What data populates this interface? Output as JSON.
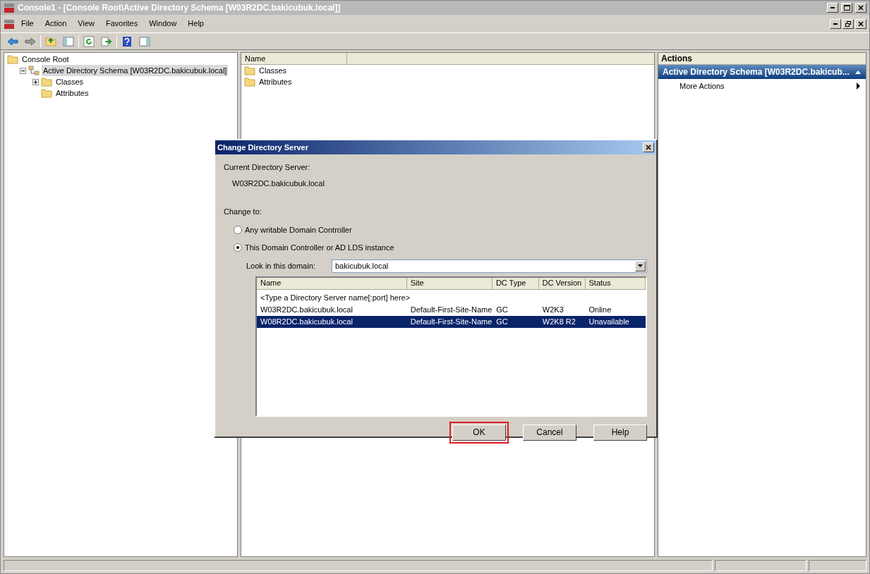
{
  "window": {
    "title": "Console1 - [Console Root\\Active Directory Schema [W03R2DC.bakicubuk.local]]"
  },
  "menu": [
    "File",
    "Action",
    "View",
    "Favorites",
    "Window",
    "Help"
  ],
  "tree": [
    {
      "label": "Console Root",
      "selected": false,
      "children": [
        {
          "label": "Active Directory Schema [W03R2DC.bakicubuk.local]",
          "kind": "branch",
          "expanded": true,
          "selected": true,
          "children": [
            {
              "label": "Classes",
              "kind": "branch",
              "expanded": false,
              "selected": false
            },
            {
              "label": "Attributes",
              "kind": "leaf",
              "selected": false
            }
          ]
        }
      ]
    }
  ],
  "list": {
    "columns": [
      "Name"
    ],
    "items": [
      "Classes",
      "Attributes"
    ]
  },
  "actions": {
    "title": "Actions",
    "section": "Active Directory Schema [W03R2DC.bakicub...",
    "items": [
      "More Actions"
    ]
  },
  "dialog": {
    "title": "Change Directory Server",
    "current_label": "Current Directory Server:",
    "current_value": "W03R2DC.bakicubuk.local",
    "change_label": "Change to:",
    "options": [
      {
        "label": "Any writable Domain Controller",
        "selected": false
      },
      {
        "label": "This Domain Controller or AD LDS instance",
        "selected": true
      }
    ],
    "domain_label": "Look in this domain:",
    "domain_value": "bakicubuk.local",
    "table": {
      "columns": [
        "Name",
        "Site",
        "DC Type",
        "DC Version",
        "Status"
      ],
      "rows": [
        {
          "cells": [
            "<Type a Directory Server name[:port] here>"
          ],
          "selected": false
        },
        {
          "cells": [
            "W03R2DC.bakicubuk.local",
            "Default-First-Site-Name",
            "GC",
            "W2K3",
            "Online"
          ],
          "selected": false
        },
        {
          "cells": [
            "W08R2DC.bakicubuk.local",
            "Default-First-Site-Name",
            "GC",
            "W2K8 R2",
            "Unavailable"
          ],
          "selected": true
        }
      ]
    },
    "buttons": [
      {
        "label": "OK",
        "highlighted": true
      },
      {
        "label": "Cancel",
        "highlighted": false
      },
      {
        "label": "Help",
        "highlighted": false
      }
    ]
  }
}
